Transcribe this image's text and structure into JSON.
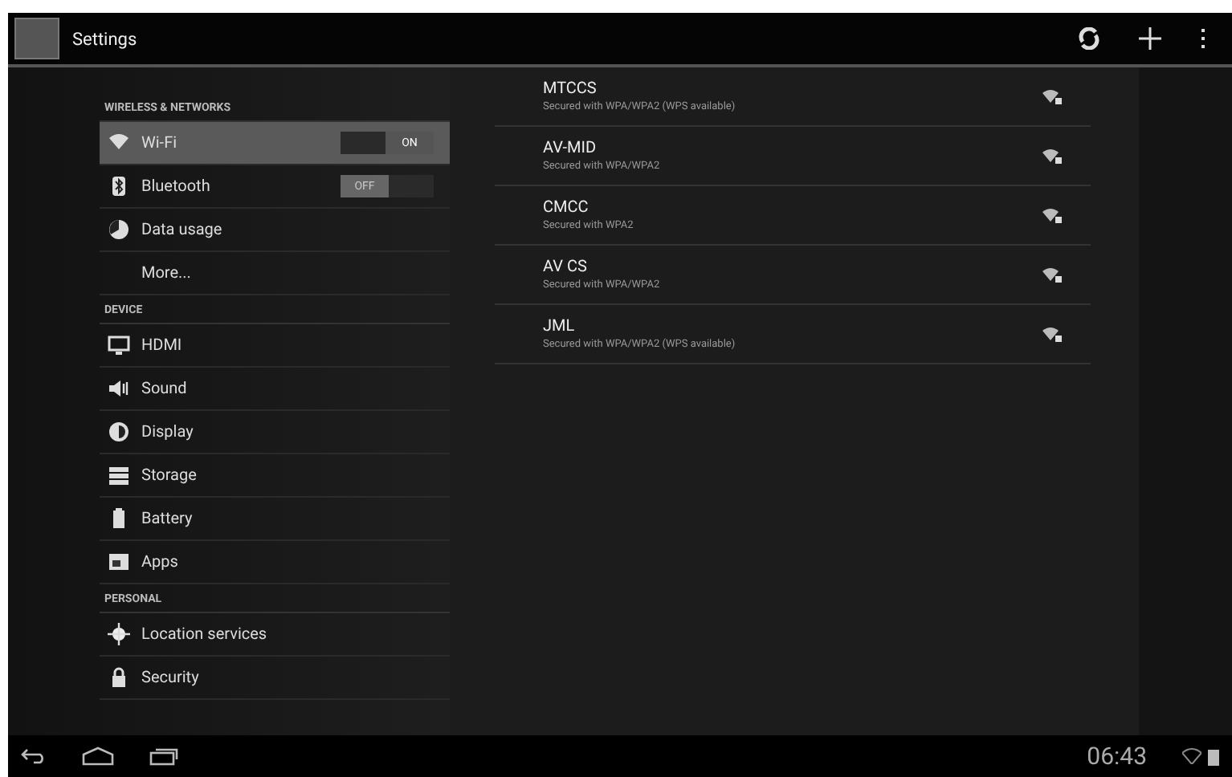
{
  "action_bar": {
    "title": "Settings"
  },
  "sidebar": {
    "sections": [
      {
        "header": "WIRELESS & NETWORKS",
        "items": [
          {
            "label": "Wi-Fi",
            "kind": "wifi",
            "selected": true,
            "toggle": {
              "on": true,
              "label": "ON"
            }
          },
          {
            "label": "Bluetooth",
            "kind": "bluetooth",
            "selected": false,
            "toggle": {
              "on": false,
              "label": "OFF"
            }
          },
          {
            "label": "Data usage",
            "kind": "data",
            "selected": false
          },
          {
            "label": "More...",
            "kind": "more",
            "selected": false
          }
        ]
      },
      {
        "header": "DEVICE",
        "items": [
          {
            "label": "HDMI",
            "kind": "hdmi",
            "selected": false
          },
          {
            "label": "Sound",
            "kind": "sound",
            "selected": false
          },
          {
            "label": "Display",
            "kind": "display",
            "selected": false
          },
          {
            "label": "Storage",
            "kind": "storage",
            "selected": false
          },
          {
            "label": "Battery",
            "kind": "battery",
            "selected": false
          },
          {
            "label": "Apps",
            "kind": "apps",
            "selected": false
          }
        ]
      },
      {
        "header": "PERSONAL",
        "items": [
          {
            "label": "Location services",
            "kind": "location",
            "selected": false
          },
          {
            "label": "Security",
            "kind": "security",
            "selected": false
          }
        ]
      }
    ]
  },
  "networks": [
    {
      "name": "MTCCS",
      "security": "Secured with WPA/WPA2 (WPS available)"
    },
    {
      "name": "AV-MID",
      "security": "Secured with WPA/WPA2"
    },
    {
      "name": "CMCC",
      "security": "Secured with WPA2"
    },
    {
      "name": "AV CS",
      "security": "Secured with WPA/WPA2"
    },
    {
      "name": "JML",
      "security": "Secured with WPA/WPA2 (WPS available)"
    }
  ],
  "status_bar": {
    "time": "06:43"
  }
}
